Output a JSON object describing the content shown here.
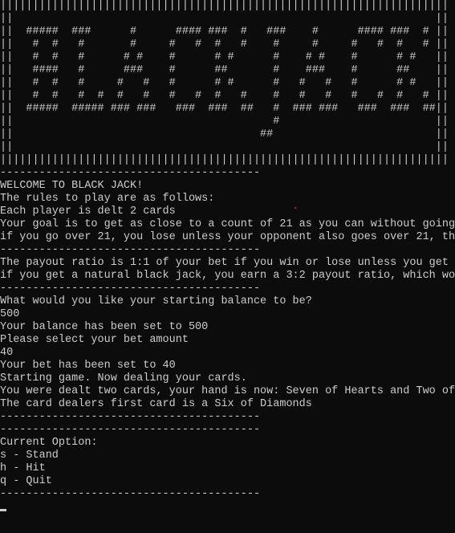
{
  "console": {
    "banner": [
      "|||||||||||||||||||||||||||||||||||||||||||||||||||||||||||||||||||||",
      "||                                                                 ||",
      "||  #####  ###      #      #### ###  #   ###    #      #### ###  # ||",
      "||   #  #   #       #     #   #  #   #    #     #     #   #  #   # ||",
      "||   #  #   #      # #    #      # #      #    # #    #      # #   ||",
      "||   ####   #      ###    #      ##       #    ###    #      ##    ||",
      "||   #  #   #     #   #   #      # #      #   #   #   #      # #   ||",
      "||   #  #   #  #  #   #   #   #  #   #    #   #   #   #   #  #   # ||",
      "||  #####  ##### ### ###   ###  ###  ##   #  ### ###   ###  ###  ##||",
      "||                                        #                        ||",
      "||                                      ##                         ||",
      "||                                                                 ||",
      "|||||||||||||||||||||||||||||||||||||||||||||||||||||||||||||||||||||"
    ],
    "lines": [
      "----------------------------------------",
      "WELCOME TO BLACK JACK!",
      "The rules to play are as follows:",
      "Each player is delt 2 cards",
      "Your goal is to get as close to a count of 21 as you can without going",
      "if you go over 21, you lose unless your opponent also goes over 21, the",
      "----------------------------------------",
      "The payout ratio is 1:1 of your bet if you win or lose unless you get a",
      "if you get a natural black jack, you earn a 3:2 payout ratio, which wou",
      "----------------------------------------",
      "What would you like your starting balance to be?",
      "500",
      "Your balance has been set to 500",
      "Please select your bet amount",
      "40",
      "Your bet has been set to 40",
      "Starting game. Now dealing your cards.",
      "You were dealt two cards, your hand is now: Seven of Hearts and Two of",
      "The card dealers first card is a Six of Diamonds",
      "----------------------------------------",
      "----------------------------------------",
      "Current Option:",
      "s - Stand",
      "h - Hit",
      "q - Quit",
      "----------------------------------------"
    ]
  },
  "colors": {
    "background": "#0c0c0c",
    "text": "#cccccc",
    "dot": "#c50f1f"
  }
}
